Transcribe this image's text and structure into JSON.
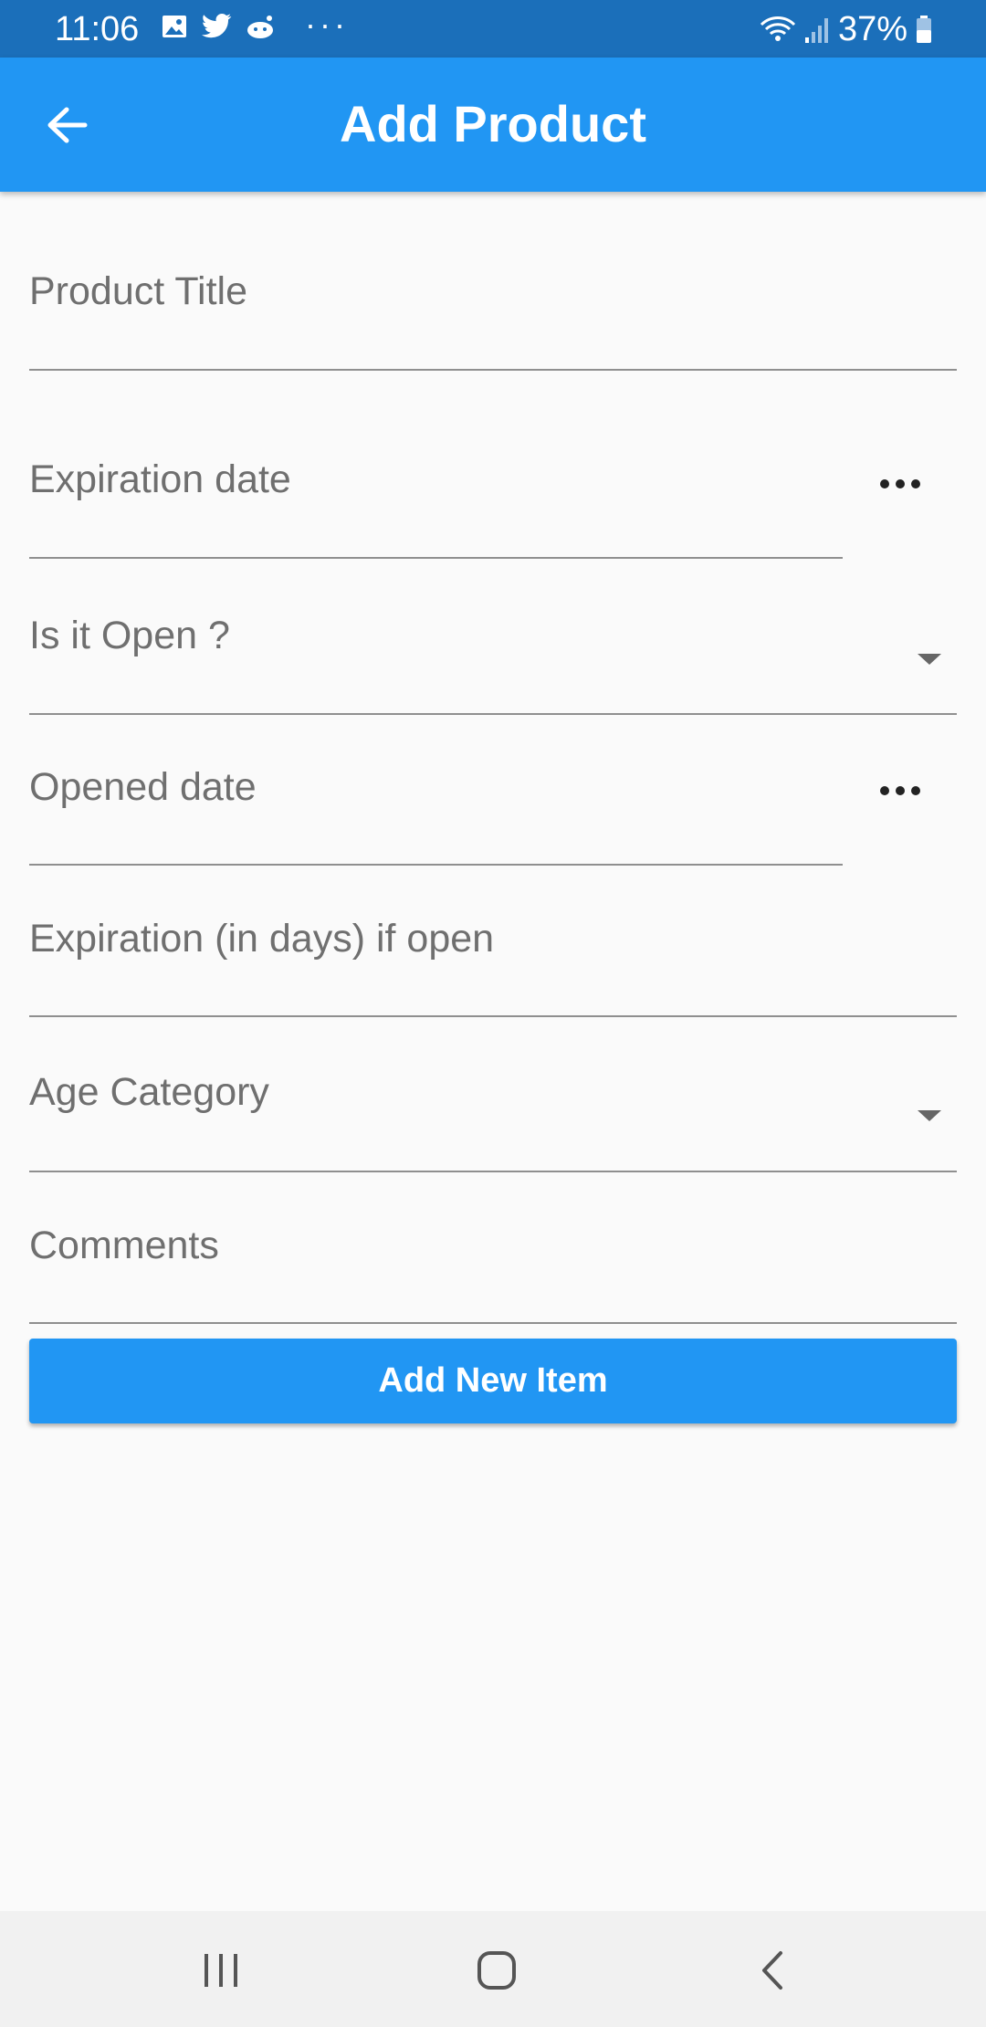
{
  "status_bar": {
    "time": "11:06",
    "left_icons": [
      "gallery-icon",
      "twitter-icon",
      "reddit-icon"
    ],
    "more": "···",
    "battery": "37%"
  },
  "app_bar": {
    "title": "Add Product",
    "back_icon": "arrow-left-icon",
    "color": "#2196f3"
  },
  "form": {
    "product_title": {
      "label": "Product Title"
    },
    "expiration_date": {
      "label": "Expiration date",
      "action_icon": "more-horiz-icon"
    },
    "is_open": {
      "label": "Is it Open ?",
      "selected": ""
    },
    "opened_date": {
      "label": "Opened date",
      "action_icon": "more-horiz-icon"
    },
    "expiration_days": {
      "label": "Expiration (in days) if open"
    },
    "age_category": {
      "label": "Age Category",
      "selected": ""
    },
    "comments": {
      "label": "Comments"
    }
  },
  "add_button": {
    "label": "Add New Item"
  },
  "nav_bar": {
    "items": [
      "recents-icon",
      "home-icon",
      "back-icon"
    ]
  }
}
